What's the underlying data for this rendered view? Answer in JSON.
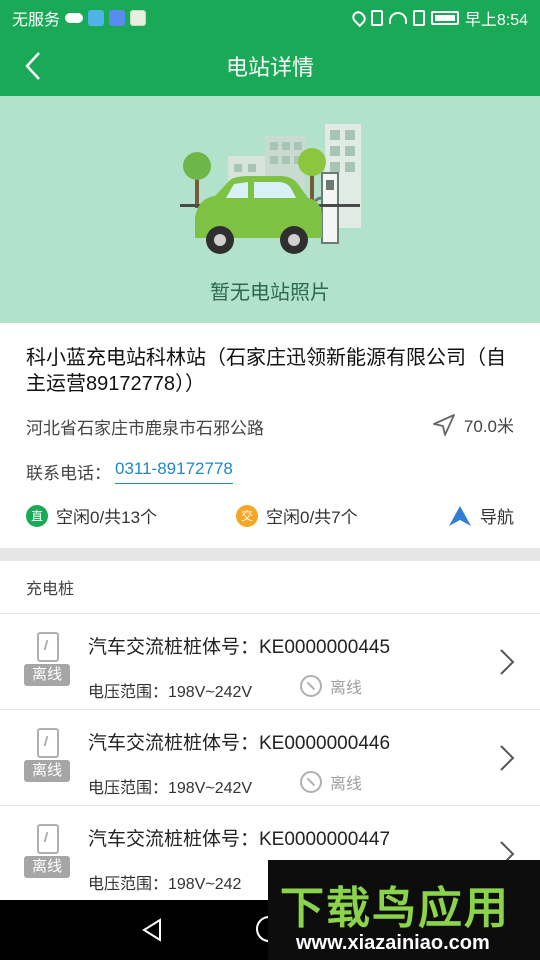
{
  "status_bar": {
    "carrier": "无服务",
    "time": "早上8:54"
  },
  "header": {
    "title": "电站详情"
  },
  "hero": {
    "caption": "暂无电站照片"
  },
  "station": {
    "name": "科小蓝充电站科林站（石家庄迅领新能源有限公司（自主运营89172778））",
    "address": "河北省石家庄市鹿泉市石邪公路",
    "distance": "70.0米",
    "phone_label": "联系电话：",
    "phone": "0311-89172778",
    "dc": {
      "badge": "直",
      "text": "空闲0/共13个"
    },
    "ac": {
      "badge": "交",
      "text": "空闲0/共7个"
    },
    "navigate_label": "导航"
  },
  "piles_section": {
    "title": "充电桩",
    "items": [
      {
        "status_tag": "离线",
        "title": "汽车交流桩桩体号：KE0000000445",
        "range": "电压范围：198V~242V",
        "state": "离线"
      },
      {
        "status_tag": "离线",
        "title": "汽车交流桩桩体号：KE0000000446",
        "range": "电压范围：198V~242V",
        "state": "离线"
      },
      {
        "status_tag": "离线",
        "title": "汽车交流桩桩体号：KE0000000447",
        "range": "电压范围：198V~242",
        "state": ""
      }
    ]
  },
  "watermark": {
    "title": "下载鸟应用",
    "url": "www.xiazainiao.com"
  },
  "colors": {
    "primary": "#1aa957",
    "hero_bg": "#b3e2cc",
    "link": "#1e88c8",
    "ac_badge": "#f5a623"
  }
}
